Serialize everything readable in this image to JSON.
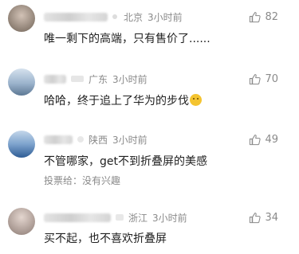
{
  "comments": [
    {
      "location": "北京",
      "time": "3小时前",
      "likes": "82",
      "text": "唯一剩下的高端，只有售价了......",
      "avatar_colors": [
        "#c8b6a8",
        "#7a6a5c"
      ]
    },
    {
      "location": "广东",
      "time": "3小时前",
      "likes": "70",
      "text": "哈哈，终于追上了华为的步伐",
      "avatar_colors": [
        "#b7c9dc",
        "#6f8aa6"
      ]
    },
    {
      "location": "陕西",
      "time": "3小时前",
      "likes": "49",
      "text": "不管哪家，get不到折叠屏的美感",
      "subline": "投票给：没有兴趣",
      "avatar_colors": [
        "#9fb8d6",
        "#3e6fa8"
      ]
    },
    {
      "location": "浙江",
      "time": "3小时前",
      "likes": "34",
      "text": "买不起，也不喜欢折叠屏",
      "avatar_colors": [
        "#d8c9c2",
        "#8c7b74"
      ]
    }
  ],
  "icons": {
    "like": "thumbs-up-icon",
    "emoji": "thinking-face-emoji"
  }
}
